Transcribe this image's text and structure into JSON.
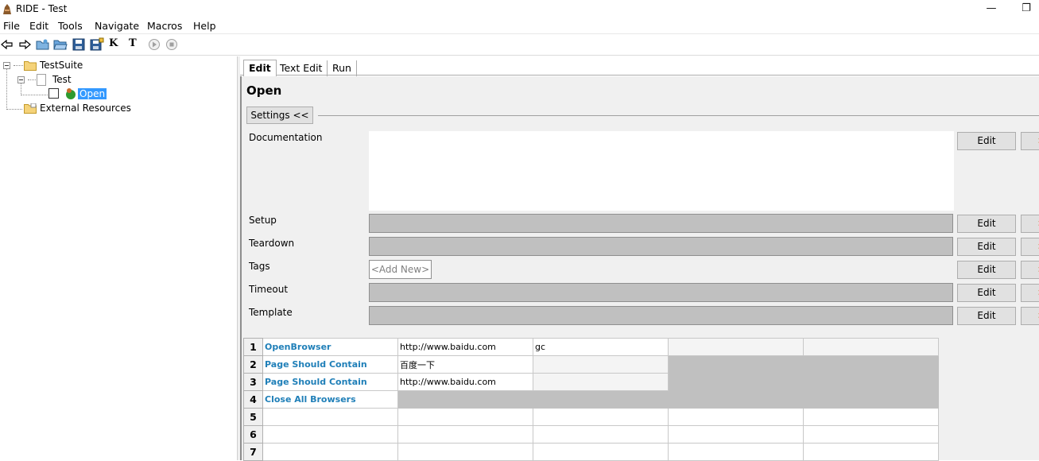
{
  "window": {
    "title": "RIDE - Test",
    "minimize_glyph": "—",
    "restore_glyph": "❐"
  },
  "menu": {
    "items": [
      "File",
      "Edit",
      "Tools",
      "Navigate",
      "Macros",
      "Help"
    ]
  },
  "toolbar": {
    "icons": [
      "back-arrow-icon",
      "forward-arrow-icon",
      "open-directory-icon",
      "open-folder-icon",
      "save-icon",
      "save-all-icon",
      "search-keywords-icon",
      "search-tests-icon",
      "run-icon",
      "stop-icon"
    ],
    "k_glyph": "K",
    "t_glyph": "T"
  },
  "tree": {
    "suite": "TestSuite",
    "test_file": "Test",
    "test_case": "Open",
    "external": "External Resources"
  },
  "tabs": [
    "Edit",
    "Text Edit",
    "Run"
  ],
  "editor": {
    "title": "Open",
    "settings_toggle": "Settings <<",
    "settings": [
      {
        "label": "Documentation",
        "value": ""
      },
      {
        "label": "Setup",
        "value": ""
      },
      {
        "label": "Teardown",
        "value": ""
      },
      {
        "label": "Tags",
        "value": "<Add New>"
      },
      {
        "label": "Timeout",
        "value": ""
      },
      {
        "label": "Template",
        "value": ""
      }
    ],
    "edit_label": "Edit",
    "clear_label": "×"
  },
  "grid": {
    "rows": [
      {
        "num": "1",
        "cells": [
          "OpenBrowser",
          "http://www.baidu.com",
          "gc",
          "",
          ""
        ]
      },
      {
        "num": "2",
        "cells": [
          "Page Should Contain",
          "百度一下",
          "",
          "",
          ""
        ]
      },
      {
        "num": "3",
        "cells": [
          "Page Should Contain",
          "http://www.baidu.com",
          "",
          "",
          ""
        ]
      },
      {
        "num": "4",
        "cells": [
          "Close All Browsers",
          "",
          "",
          "",
          ""
        ]
      },
      {
        "num": "5",
        "cells": [
          "",
          "",
          "",
          "",
          ""
        ]
      },
      {
        "num": "6",
        "cells": [
          "",
          "",
          "",
          "",
          ""
        ]
      },
      {
        "num": "7",
        "cells": [
          "",
          "",
          "",
          "",
          ""
        ]
      }
    ]
  },
  "colors": {
    "selection": "#3399ff",
    "keyword": "#1f7fb8",
    "unused_cell": "#c0c0c0"
  }
}
